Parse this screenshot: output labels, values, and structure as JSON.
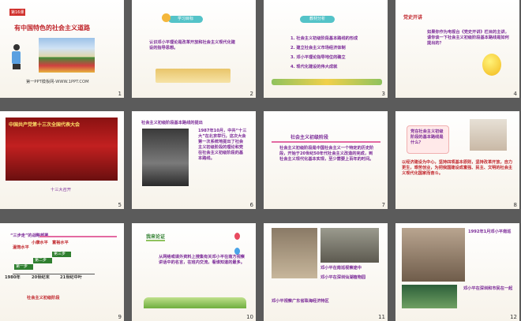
{
  "slides": [
    {
      "num": "1",
      "tag": "第16课",
      "title": "有中国特色的社会主义道路",
      "footer": "第一PPT模板网-WWW.1PPT.COM"
    },
    {
      "num": "2",
      "heading": "学习目标",
      "body": "认识邓小平理论是改革开放和社会主义现代化建设的指导思想。"
    },
    {
      "num": "3",
      "heading": "教材分析",
      "items": [
        "1. 社会主义初级阶段基本路线的形成",
        "2. 建立社会主义市场经济体制",
        "3. 邓小平理论指导地位的确立",
        "4. 现代化建设的伟大成就"
      ]
    },
    {
      "num": "4",
      "heading": "党史开讲",
      "body": "如果你作为电视台《党史开讲》栏目的主讲，请你谈一下社会主义初级阶段基本路线是如何提出的？"
    },
    {
      "num": "5",
      "banner": "中国共产党第十三次全国代表大会",
      "caption": "十三大召开"
    },
    {
      "num": "6",
      "heading": "社会主义初级阶段基本路线的提出",
      "body": "1987年10月，中共“十三大”在北京举行。这次大会第一次系统地提出了社会主义初级阶段的理论和党在社会主义初级阶段的基本路线。"
    },
    {
      "num": "7",
      "heading": "社会主义初级阶段",
      "body": "社会主义初级阶段是中国社会主义一个特定的历史阶段，开始于20世纪50年代社会主义改造的完成，到社会主义现代化基本实现，至少需要上百年的时间。"
    },
    {
      "num": "8",
      "heading": "党在社会主义初级阶段的基本路线是什么？",
      "body": "以经济建设为中心，坚持四项基本原则，坚持改革开放，自力更生，艰苦创业，为把我国建设成富强、民主、文明的社会主义现代化国家而奋斗。"
    },
    {
      "num": "9",
      "heading": "“三步走”的战略部署",
      "steps": [
        "第一步",
        "第二步",
        "第三步"
      ],
      "labels": [
        "温饱水平",
        "小康水平",
        "富裕水平"
      ],
      "years": [
        "1980年",
        "20世纪末",
        "21世纪中叶"
      ],
      "footer": "社会主义初级阶段"
    },
    {
      "num": "10",
      "heading": "我来论证",
      "body": "从网络或课外资料上搜集有关邓小平在南方视察讲话中的名言，在班内交流，看谁知道的最多。"
    },
    {
      "num": "11",
      "caption1": "邓小平在南巡视察途中",
      "caption2": "邓小平在深圳仙湖植物园",
      "caption3": "邓小平视察广东省珠海经济特区"
    },
    {
      "num": "12",
      "caption1": "1992年1月邓小平南巡",
      "caption2": "邓小平在深圳和市民在一起"
    }
  ],
  "colors": {
    "purple": "#7b2a98",
    "pink": "#e36aa2",
    "green": "#2f7f2f",
    "red": "#b01e1e"
  }
}
